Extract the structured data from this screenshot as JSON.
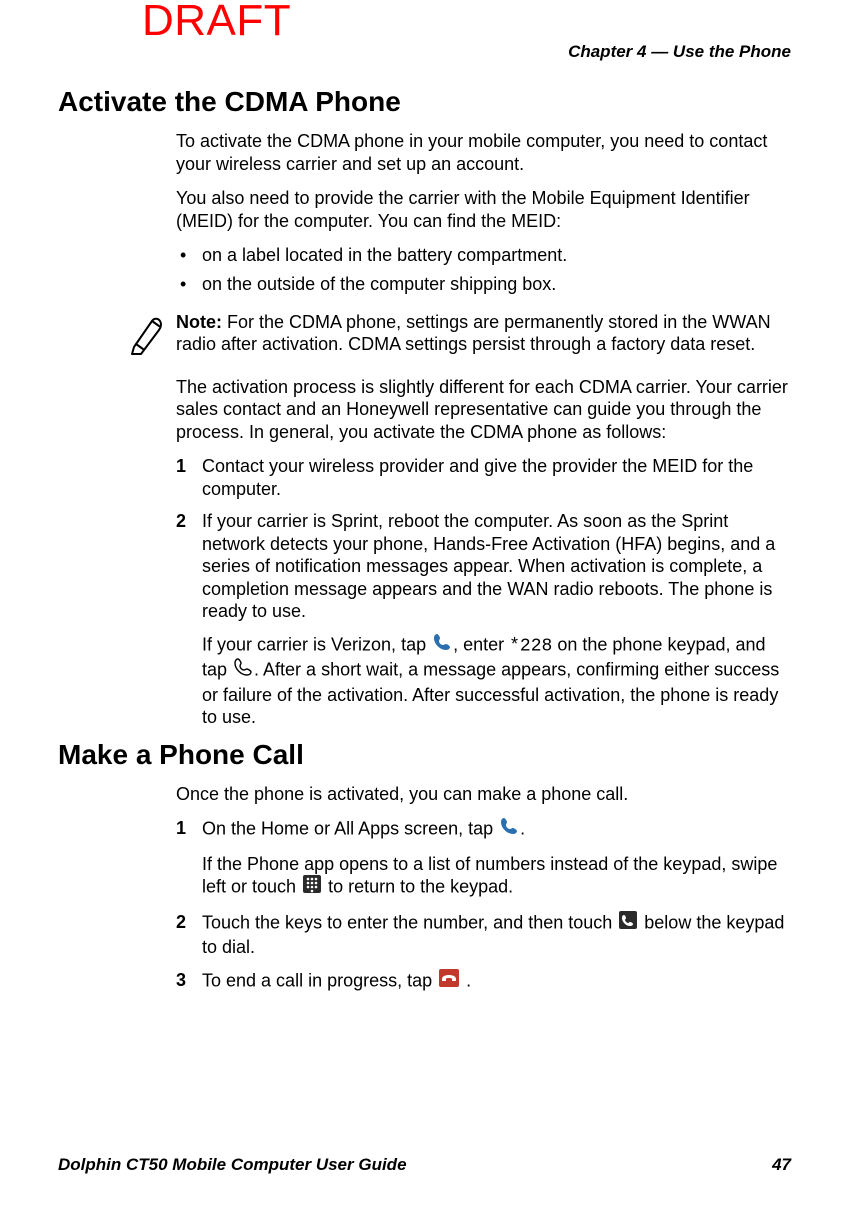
{
  "watermark": "DRAFT",
  "chapter_header": "Chapter 4 — Use the Phone",
  "footer": {
    "title": "Dolphin CT50 Mobile Computer User Guide",
    "page": "47"
  },
  "section1": {
    "title": "Activate the CDMA Phone",
    "p1": "To activate the CDMA phone in your mobile computer, you need to contact your wireless carrier and set up an account.",
    "p2": "You also need to provide the carrier with the Mobile Equipment Identifier (MEID) for the computer. You can find the MEID:",
    "bullets": [
      "on a label located in the battery compartment.",
      "on the outside of the computer shipping box."
    ],
    "note_label": "Note:",
    "note_body": " For the CDMA phone, settings are permanently stored in the WWAN radio after activation. CDMA settings persist through a factory data reset.",
    "p3": "The activation process is slightly different for each CDMA carrier. Your carrier sales contact and an Honeywell representative can guide you through the process. In general, you activate the CDMA phone as follows:",
    "steps": {
      "s1": "Contact your wireless provider and give the provider the MEID for the computer.",
      "s2_a": "If your carrier is Sprint, reboot the computer. As soon as the Sprint network detects your phone, Hands-Free Activation (HFA) begins, and a series of notification messages appear. When activation is complete, a completion message appears and the WAN radio reboots. The phone is ready to use.",
      "s2_b_pre": "If your carrier is Verizon, tap ",
      "s2_b_mid1": ", enter ",
      "s2_b_code": "*228",
      "s2_b_mid2": " on the phone keypad, and tap ",
      "s2_b_post": ". After a short wait, a message appears, confirming either success or failure of the activation. After successful activation, the phone is ready to use."
    }
  },
  "section2": {
    "title": "Make a Phone Call",
    "p1": "Once the phone is activated, you can make a phone call.",
    "steps": {
      "s1_pre": "On the Home or All Apps screen, tap ",
      "s1_post": ".",
      "s1_sub_pre": "If the Phone app opens to a list of numbers instead of the keypad, swipe left or touch ",
      "s1_sub_post": " to return to the keypad.",
      "s2_pre": "Touch the keys to enter the number, and then touch ",
      "s2_post": " below the keypad to dial.",
      "s3_pre": "To end a call in progress, tap ",
      "s3_post": " ."
    }
  }
}
